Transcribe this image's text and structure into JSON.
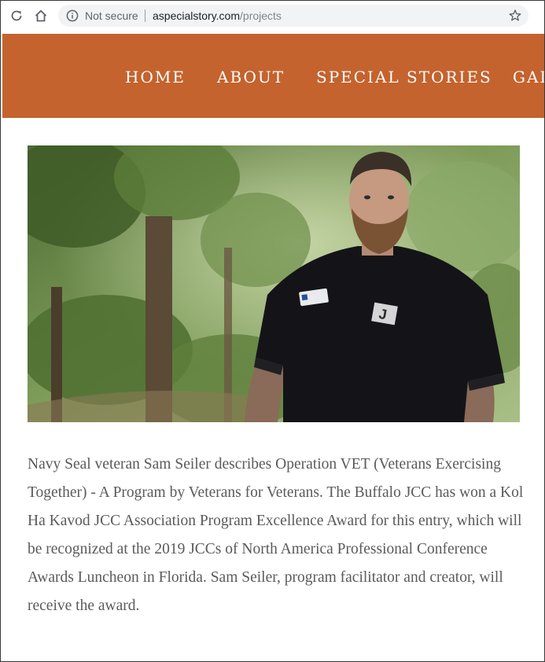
{
  "browser": {
    "security_label": "Not secure",
    "url_host": "aspecialstory.com",
    "url_path": "/projects",
    "icons": [
      "reload-icon",
      "home-icon",
      "info-icon",
      "star-icon"
    ]
  },
  "nav": {
    "items": [
      {
        "label": "HOME"
      },
      {
        "label": "ABOUT"
      },
      {
        "label": "SPECIAL STORIES"
      },
      {
        "label": "GAL"
      }
    ]
  },
  "hero": {
    "badge_letter": "J"
  },
  "article": {
    "body": "Navy Seal veteran Sam Seiler describes Operation VET (Veterans Exercising Together) - A Program by Veterans for Veterans. The Buffalo JCC has won a Kol Ha Kavod JCC Association Program Excellence Award for this entry, which will be recognized at the 2019 JCCs of North America Professional Conference Awards Luncheon  in Florida. Sam Seiler, program facilitator and creator, will receive the award."
  },
  "colors": {
    "nav_background": "#c4632e",
    "body_text": "#5a5a5a"
  }
}
